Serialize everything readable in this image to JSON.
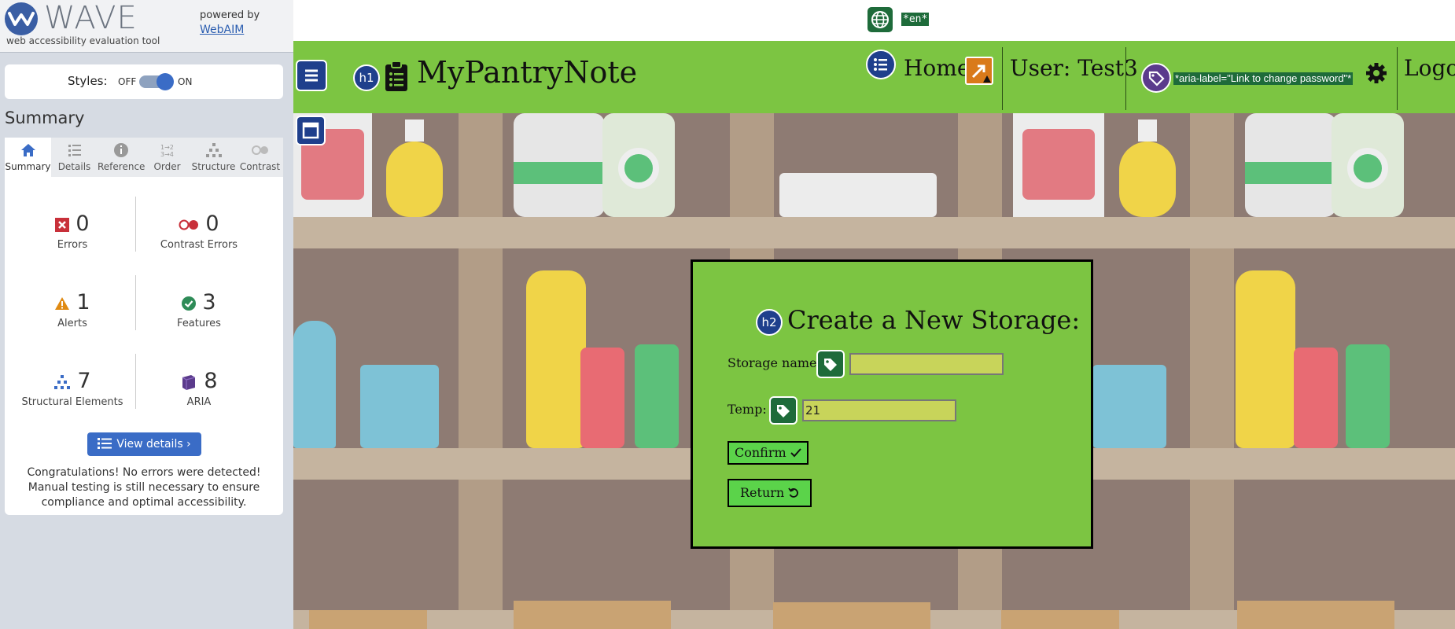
{
  "wave": {
    "logo_text": "WAVE",
    "tagline": "web accessibility evaluation tool",
    "powered_by": "powered by",
    "webaim_link": "WebAIM",
    "styles_label": "Styles:",
    "styles_off": "OFF",
    "styles_on": "ON",
    "styles_toggle_on": true,
    "summary_title": "Summary",
    "tabs": [
      {
        "label": "Summary",
        "icon": "home-icon",
        "active": true
      },
      {
        "label": "Details",
        "icon": "list-icon"
      },
      {
        "label": "Reference",
        "icon": "info-icon"
      },
      {
        "label": "Order",
        "icon": "order-icon"
      },
      {
        "label": "Structure",
        "icon": "structure-icon"
      },
      {
        "label": "Contrast",
        "icon": "contrast-icon"
      }
    ],
    "stats": {
      "errors": {
        "value": "0",
        "label": "Errors",
        "color": "#c8303a"
      },
      "contrast_errors": {
        "value": "0",
        "label": "Contrast Errors",
        "color": "#c8303a"
      },
      "alerts": {
        "value": "1",
        "label": "Alerts",
        "color": "#e08a12"
      },
      "features": {
        "value": "3",
        "label": "Features",
        "color": "#2e8b57"
      },
      "structural": {
        "value": "7",
        "label": "Structural Elements",
        "color": "#3a6cc6"
      },
      "aria": {
        "value": "8",
        "label": "ARIA",
        "color": "#5b3b8c"
      }
    },
    "view_details": "View details ›",
    "congrats": "Congratulations! No errors were detected! Manual testing is still necessary to ensure compliance and optimal accessibility."
  },
  "page": {
    "lang_badge": "*en*",
    "brand": "MyPantryNote",
    "h1_badge": "h1",
    "nav": {
      "home": "Home",
      "user": "User: Test3",
      "aria_label": "*aria-label=\"Link to change password\"*",
      "logout": "Logo"
    },
    "modal": {
      "h2_badge": "h2",
      "title": "Create a New Storage:",
      "storage_name_label": "Storage name:",
      "storage_name_value": "",
      "temp_label": "Temp:",
      "temp_value": "21",
      "confirm": "Confirm",
      "return": "Return"
    },
    "colors": {
      "accent_green": "#7cc542",
      "wave_blue": "#3a6cc6",
      "wave_icon_green": "#1e6b3a"
    }
  }
}
